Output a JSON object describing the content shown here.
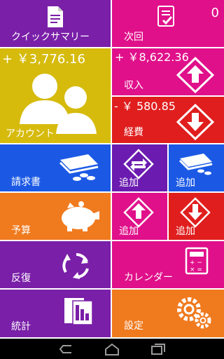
{
  "colors": {
    "purple": "#7a1fa8",
    "magenta": "#e0108a",
    "mustard": "#d6bb0d",
    "red": "#e01e1e",
    "blue": "#1b59e5",
    "orange": "#f07a1e",
    "darkpurple": "#6b1bb0"
  },
  "tiles": {
    "quick_summary": {
      "label": "クイックサマリー",
      "icon": "document-icon"
    },
    "next": {
      "label": "次回",
      "count": "0",
      "icon": "checklist-icon"
    },
    "account": {
      "label": "アカウント",
      "amount": "+ ￥3,776.16",
      "icon": "people-silhouette-icon"
    },
    "income": {
      "label": "収入",
      "amount": "+ ￥8,622.36",
      "icon": "up-arrow-icon"
    },
    "expense": {
      "label": "経費",
      "amount": "- ￥ 580.85",
      "icon": "down-arrow-icon"
    },
    "bills": {
      "label": "請求書",
      "icon": "money-stack-icon"
    },
    "add_transfer": {
      "label": "追加",
      "icon": "transfer-icon"
    },
    "add_bill": {
      "label": "追加",
      "icon": "money-stack-icon"
    },
    "budget": {
      "label": "予算",
      "icon": "piggy-bank-icon"
    },
    "add_income": {
      "label": "追加",
      "icon": "up-arrow-icon"
    },
    "add_expense": {
      "label": "追加",
      "icon": "down-arrow-icon"
    },
    "repeat": {
      "label": "反復",
      "icon": "repeat-icon"
    },
    "calendar": {
      "label": "カレンダー",
      "icon": "calculator-icon"
    },
    "stats": {
      "label": "統計",
      "icon": "report-icon"
    },
    "settings": {
      "label": "設定",
      "icon": "gears-icon"
    }
  },
  "navbar": {
    "back": "back-icon",
    "home": "home-icon",
    "recents": "recents-icon"
  }
}
